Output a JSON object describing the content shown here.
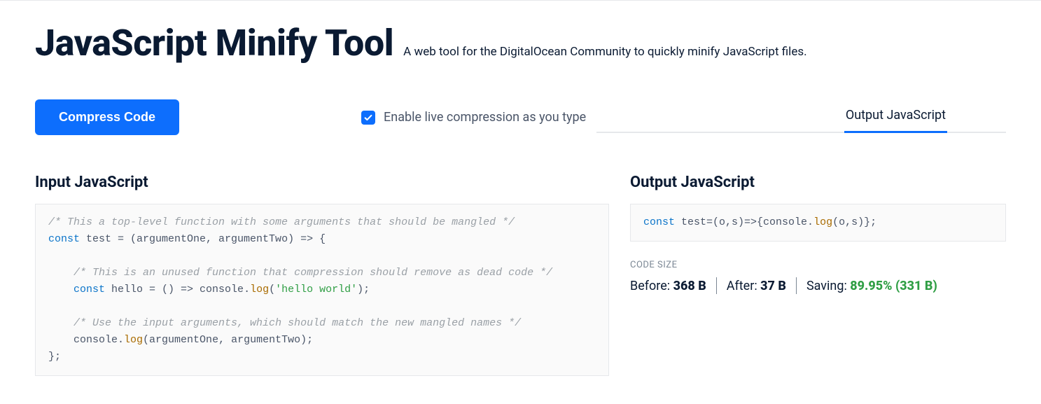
{
  "header": {
    "title": "JavaScript Minify Tool",
    "subtitle": "A web tool for the DigitalOcean Community to quickly minify JavaScript files."
  },
  "controls": {
    "compress_label": "Compress Code",
    "live_checkbox_label": "Enable live compression as you type",
    "live_checked": true
  },
  "tabs": {
    "output_label": "Output JavaScript"
  },
  "input_panel": {
    "heading": "Input JavaScript",
    "code": {
      "c1": "/* This a top-level function with some arguments that should be mangled */",
      "kw_const1": "const",
      "name1": " test = (argumentOne, argumentTwo) => {",
      "c2": "/* This is an unused function that compression should remove as dead code */",
      "kw_const2": "const",
      "name2": " hello = () => console.",
      "fn_log1": "log",
      "paren_open": "(",
      "str1": "'hello world'",
      "tail1": ");",
      "c3": "/* Use the input arguments, which should match the new mangled names */",
      "line4a": "    console.",
      "fn_log2": "log",
      "line4b": "(argumentOne, argumentTwo);",
      "close": "};"
    }
  },
  "output_panel": {
    "heading": "Output JavaScript",
    "code": {
      "kw_const": "const",
      "mid": " test=(o,s)=>{console.",
      "fn_log": "log",
      "tail": "(o,s)};"
    }
  },
  "stats": {
    "section_label": "CODE SIZE",
    "before_label": "Before: ",
    "before_value": "368 B",
    "after_label": "After: ",
    "after_value": "37 B",
    "saving_label": "Saving: ",
    "saving_value": "89.95% (331 B)"
  }
}
